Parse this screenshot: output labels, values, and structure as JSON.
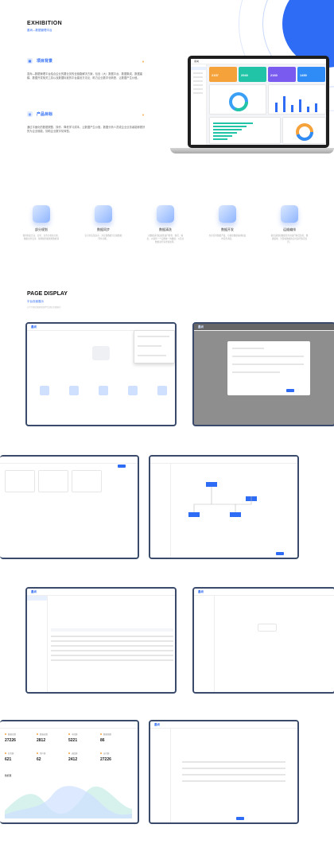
{
  "exhibition": {
    "title": "EXHIBITION",
    "subtitle": "墨尚—数据管理平台"
  },
  "sections": [
    {
      "title": "项目背景",
      "text": "墨尚—数据管理平台结合企业的要业务的全链路解决方案，包含（大）数据平台、数据集成、数据建模、数据开发相关工具以及数据标准的平台建设方法论，助力企业数字化转型、让数据产生价值。"
    },
    {
      "title": "产品目标",
      "text": "通过平面化的数据规整、操作、降低学习成本，让数据产生价值，数据分析人员或企业业务者能够更好的为企业赋能，协助企业数字化转型。"
    }
  ],
  "laptop": {
    "logo": "墨尚",
    "stat_colors": [
      "#f6a23a",
      "#22c4a8",
      "#7a5bf0",
      "#2f8cf6"
    ],
    "stat_values": [
      "2157",
      "2940",
      "2160",
      "1450"
    ]
  },
  "features": [
    {
      "name": "部分规划",
      "icon": "planning-icon",
      "desc": "规划制定企业、业务、业务分类和分类、数据业务层次、规则规划和规划数据调"
    },
    {
      "name": "数据同步",
      "icon": "sync-icon",
      "desc": "实可化实现多库，并实现数据导出和数据同步功能。"
    },
    {
      "name": "数据清洗",
      "icon": "clean-icon",
      "desc": "对数据清洗和处理进行检查、规范、输出，以提供一个完整统一的数据，以及对数据进行清洗和处理。"
    },
    {
      "name": "数据开发",
      "icon": "develop-icon",
      "desc": "支持任务数据开发、可视化数据编排和发布任务调度。"
    },
    {
      "name": "运维编排",
      "icon": "ops-icon",
      "desc": "提供运维和数据任务的运行情况监控、数据运维、告警和数据的实时运行情况监控。"
    }
  ],
  "page_display": {
    "title": "PAGE DISPLAY",
    "subtitle": "平台页面展示",
    "caption": "以下为墨尚数据管理平台部分页面展示"
  },
  "dashboard": {
    "labels": [
      "数据库数",
      "数据表数",
      "字段数",
      "数据源数",
      "任务数",
      "用户数",
      "调度数",
      "运行数"
    ],
    "values": [
      "27226",
      "2812",
      "5221",
      "86",
      "621",
      "62",
      "2412",
      "27226"
    ],
    "chart_title": "数据量"
  }
}
